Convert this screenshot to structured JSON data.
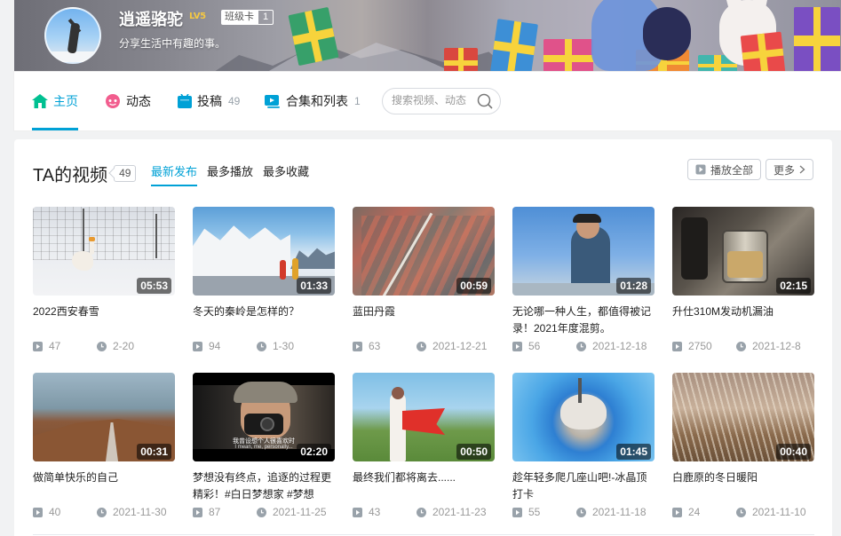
{
  "user": {
    "name": "逍遥骆驼",
    "level": "LV5",
    "card_label": "班级卡",
    "card_count": "1",
    "signature": "分享生活中有趣的事。"
  },
  "nav": {
    "tabs": [
      {
        "label": "主页",
        "count": "",
        "icon": "home-icon",
        "active": true
      },
      {
        "label": "动态",
        "count": "",
        "icon": "dynamic-icon"
      },
      {
        "label": "投稿",
        "count": "49",
        "icon": "upload-icon"
      },
      {
        "label": "合集和列表",
        "count": "1",
        "icon": "collection-icon"
      }
    ],
    "search_placeholder": "搜索视频、动态"
  },
  "videos": {
    "title": "TA的视频",
    "count": "49",
    "sort_tabs": [
      "最新发布",
      "最多播放",
      "最多收藏"
    ],
    "play_all": "播放全部",
    "more": "更多",
    "items": [
      {
        "title": "2022西安春雪",
        "duration": "05:53",
        "plays": "47",
        "date": "2-20"
      },
      {
        "title": "冬天的秦岭是怎样的？",
        "duration": "01:33",
        "plays": "94",
        "date": "1-30"
      },
      {
        "title": "蓝田丹霞",
        "duration": "00:59",
        "plays": "63",
        "date": "2021-12-21"
      },
      {
        "title": "无论哪一种人生，都值得被记录！2021年度混剪。",
        "duration": "01:28",
        "plays": "56",
        "date": "2021-12-18"
      },
      {
        "title": "升仕310M发动机漏油",
        "duration": "02:15",
        "plays": "2750",
        "date": "2021-12-8"
      },
      {
        "title": "做简单快乐的自己",
        "duration": "00:31",
        "plays": "40",
        "date": "2021-11-30"
      },
      {
        "title": "梦想没有终点，追逐的过程更精彩！#白日梦想家 #梦想",
        "duration": "02:20",
        "plays": "87",
        "date": "2021-11-25",
        "subtitle_cn": "我曾设想个人很喜欢时",
        "subtitle_en": "I mean, me, personally..."
      },
      {
        "title": "最终我们都将离去......",
        "duration": "00:50",
        "plays": "43",
        "date": "2021-11-23"
      },
      {
        "title": "趁年轻多爬几座山吧!-冰晶顶打卡",
        "duration": "01:45",
        "plays": "55",
        "date": "2021-11-18"
      },
      {
        "title": "白鹿原的冬日暖阳",
        "duration": "00:40",
        "plays": "24",
        "date": "2021-11-10"
      }
    ]
  },
  "colors": {
    "accent": "#00a1d6",
    "meta": "#999999",
    "lv": "#f5c842"
  }
}
